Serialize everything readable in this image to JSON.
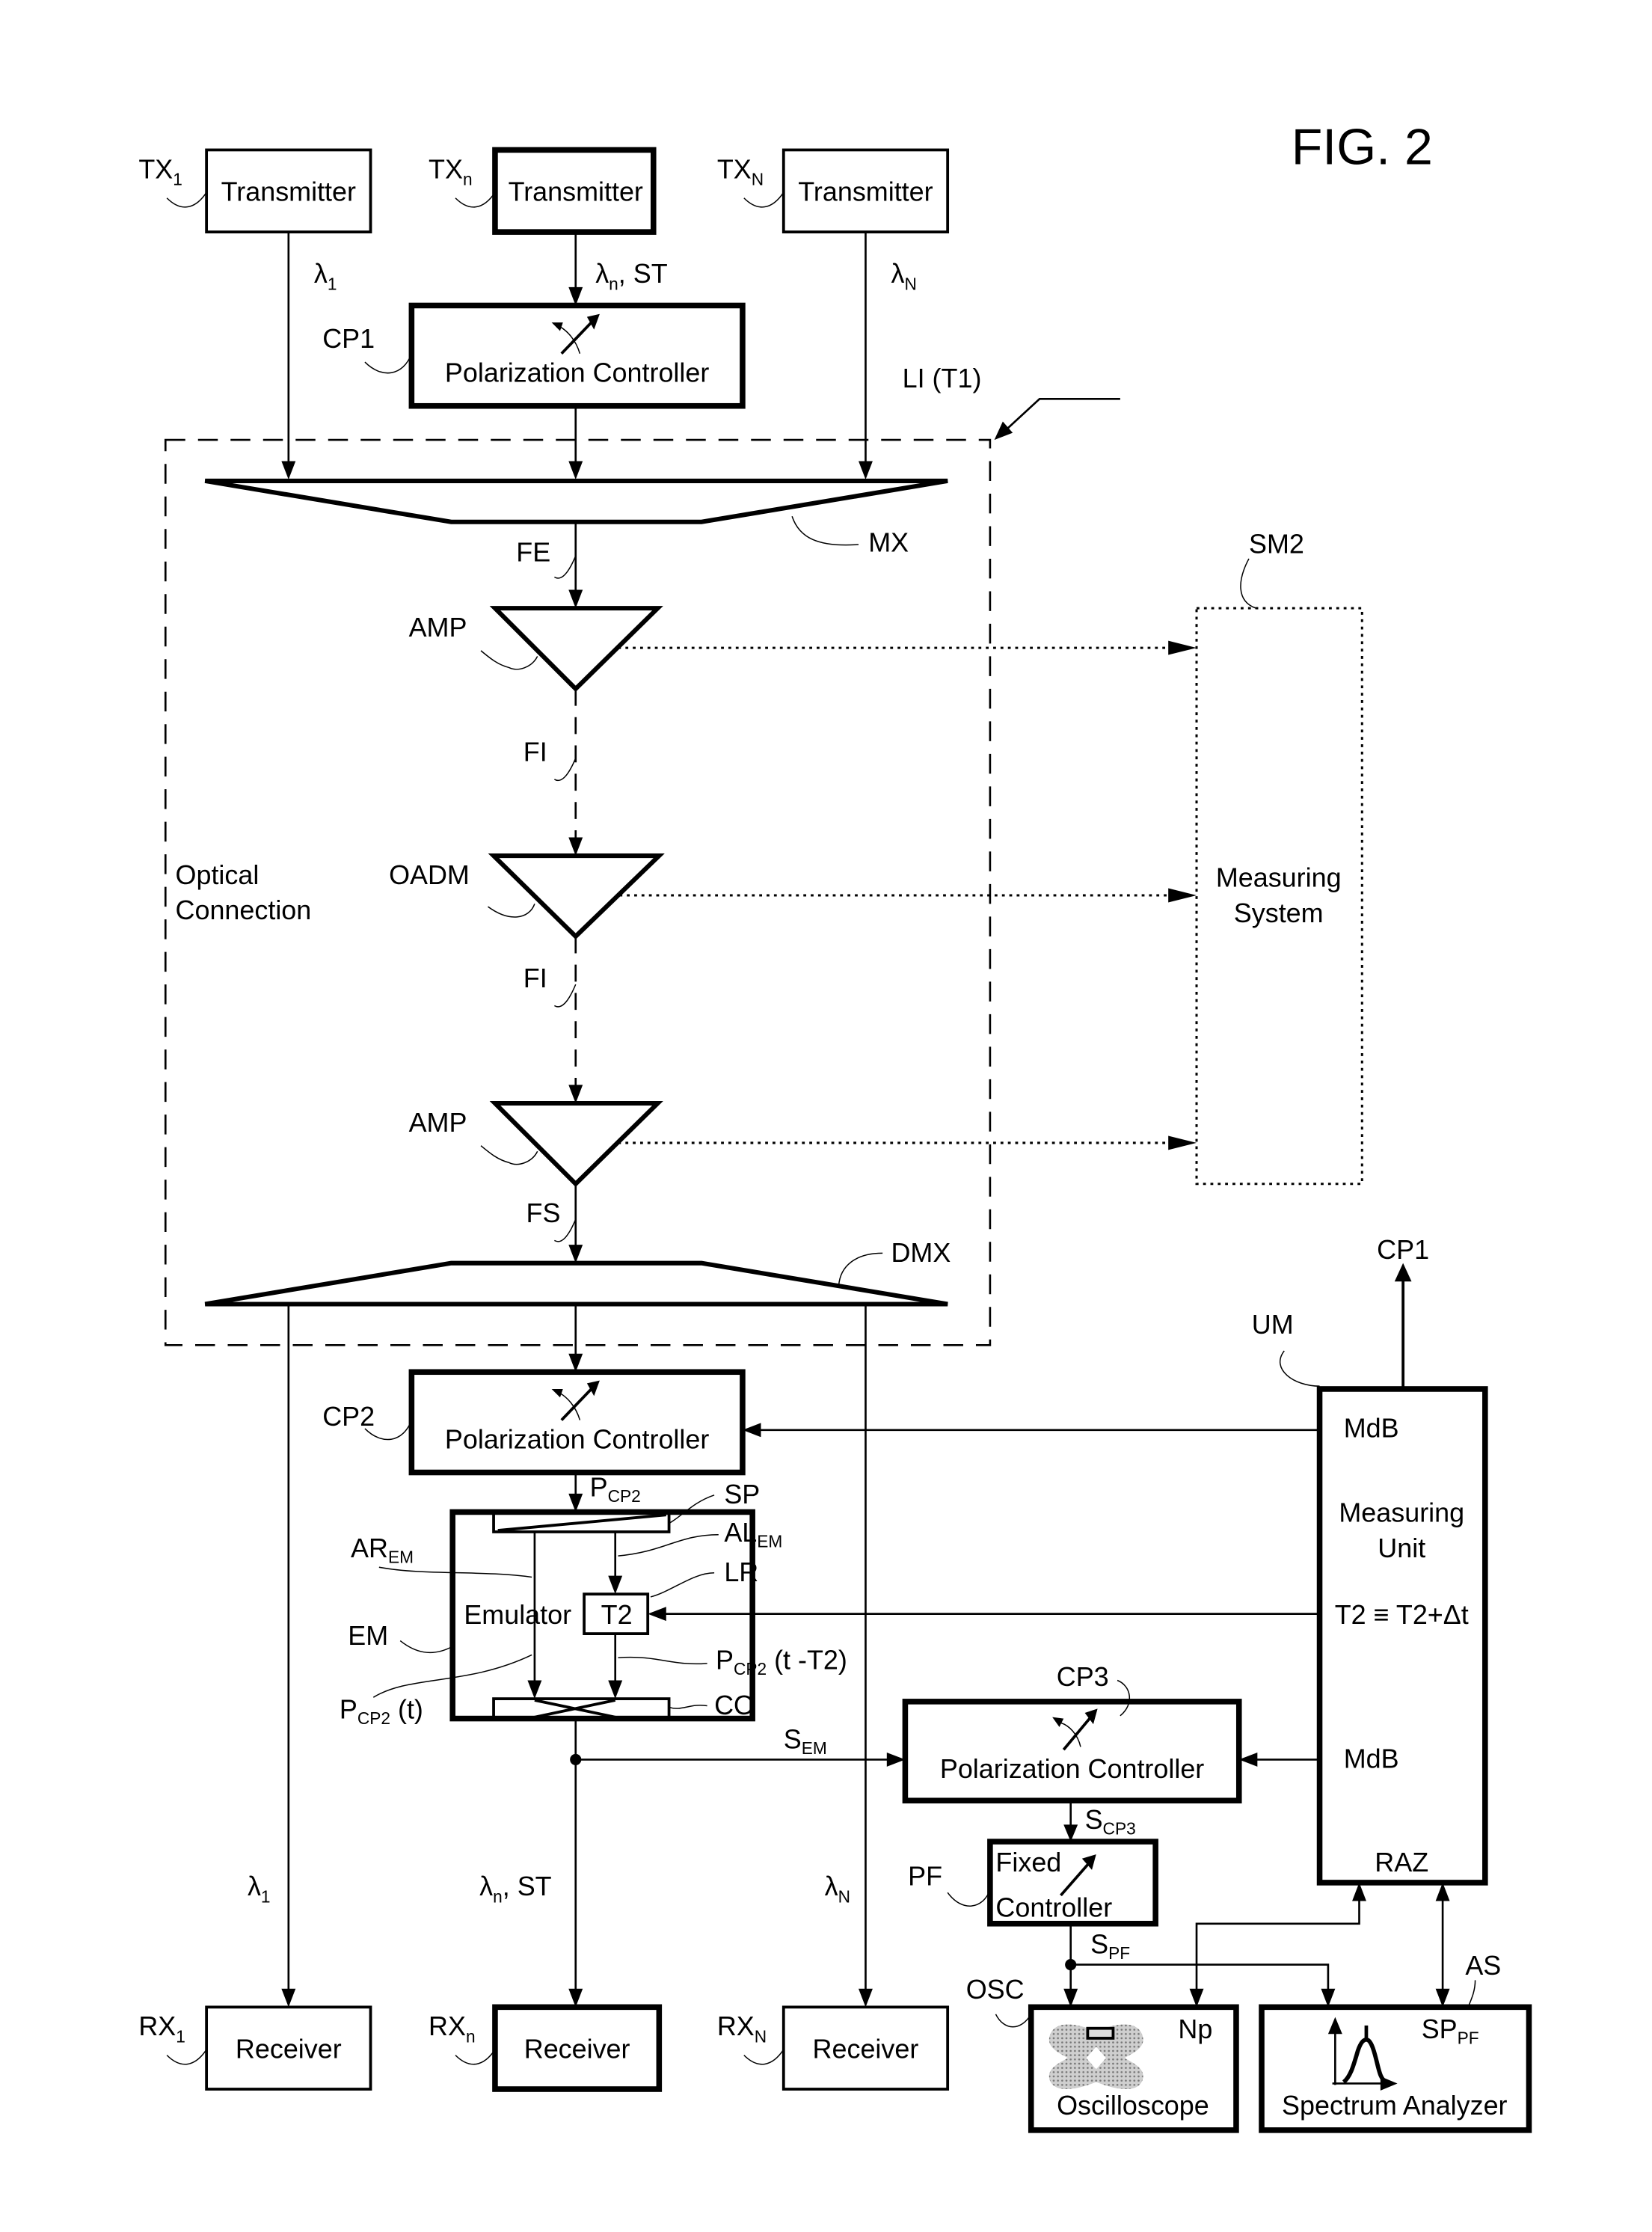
{
  "figure": {
    "title": "FIG. 2"
  },
  "transmitters": [
    {
      "ref": "TX",
      "ref_sub": "1",
      "label": "Transmitter",
      "wavelength": "λ",
      "wavelength_sub": "1",
      "wavelength_suffix": ""
    },
    {
      "ref": "TX",
      "ref_sub": "n",
      "label": "Transmitter",
      "wavelength": "λ",
      "wavelength_sub": "n",
      "wavelength_suffix": ", ST"
    },
    {
      "ref": "TX",
      "ref_sub": "N",
      "label": "Transmitter",
      "wavelength": "λ",
      "wavelength_sub": "N",
      "wavelength_suffix": ""
    }
  ],
  "cp1": {
    "ref": "CP1",
    "label": "Polarization Controller"
  },
  "link": {
    "ref": "LI (T1)",
    "region_label_line1": "Optical",
    "region_label_line2": "Connection",
    "mux_ref": "MX",
    "demux_ref": "DMX",
    "fibers": {
      "fe": "FE",
      "fi1": "FI",
      "fi2": "FI",
      "fs": "FS"
    },
    "nodes": [
      {
        "ref": "AMP"
      },
      {
        "ref": "OADM"
      },
      {
        "ref": "AMP"
      }
    ]
  },
  "measuring_system": {
    "ref": "SM2",
    "label_line1": "Measuring",
    "label_line2": "System"
  },
  "cp2": {
    "ref": "CP2",
    "label": "Polarization Controller"
  },
  "emulator": {
    "ref": "EM",
    "label": "Emulator",
    "delay_label": "T2",
    "input_signal": "P",
    "input_signal_sub": "CP2",
    "splitter_ref": "SP",
    "short_arm_ref": "AL",
    "short_arm_sub": "EM",
    "long_arm_ref": "AR",
    "long_arm_sub": "EM",
    "delay_line_ref": "LR",
    "delayed_signal": "P",
    "delayed_signal_sub": "CP2",
    "delayed_signal_suffix": " (t -T2)",
    "direct_signal": "P",
    "direct_signal_sub": "CP2",
    "direct_signal_suffix": " (t)",
    "coupler_ref": "CO",
    "output_signal": "S",
    "output_signal_sub": "EM"
  },
  "measuring_unit": {
    "ref": "UM",
    "output_ref": "CP1",
    "port_top": "MdB",
    "label_line1": "Measuring",
    "label_line2": "Unit",
    "delay_rule": "T2 ≡ T2+Δt",
    "port_bottom": "MdB",
    "reset_port": "RAZ"
  },
  "cp3": {
    "ref": "CP3",
    "label": "Polarization Controller",
    "output_signal": "S",
    "output_signal_sub": "CP3"
  },
  "fixed_controller": {
    "ref": "PF",
    "label_line1": "Fixed",
    "label_line2": "Controller",
    "output_signal": "S",
    "output_signal_sub": "PF"
  },
  "oscilloscope": {
    "ref": "OSC",
    "label": "Oscilloscope",
    "value_label": "Np"
  },
  "spectrum_analyzer": {
    "ref": "AS",
    "label": "Spectrum Analyzer",
    "value_label": "SP",
    "value_label_sub": "PF"
  },
  "receivers": [
    {
      "ref": "RX",
      "ref_sub": "1",
      "label": "Receiver",
      "wavelength": "λ",
      "wavelength_sub": "1",
      "wavelength_suffix": ""
    },
    {
      "ref": "RX",
      "ref_sub": "n",
      "label": "Receiver",
      "wavelength": "λ",
      "wavelength_sub": "n",
      "wavelength_suffix": ", ST"
    },
    {
      "ref": "RX",
      "ref_sub": "N",
      "label": "Receiver",
      "wavelength": "λ",
      "wavelength_sub": "N",
      "wavelength_suffix": ""
    }
  ]
}
